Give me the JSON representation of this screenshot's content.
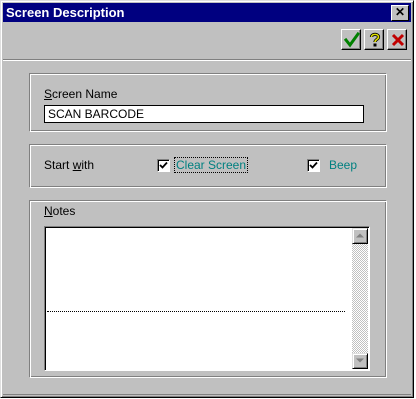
{
  "window": {
    "title": "Screen Description",
    "close_glyph": "✕"
  },
  "toolbar": {
    "ok_icon": "green-checkmark-icon",
    "help_icon": "question-mark-icon",
    "cancel_icon": "red-x-icon",
    "colors": {
      "ok": "#008000",
      "help": "#808000",
      "cancel": "#c00000"
    }
  },
  "screen_name": {
    "label_hotkey": "S",
    "label_rest": "creen Name",
    "value": "SCAN BARCODE"
  },
  "start_with": {
    "label_pre": "Start ",
    "label_hotkey": "w",
    "label_post": "ith",
    "clear_screen": {
      "label": "Clear Screen",
      "checked": true
    },
    "beep": {
      "label": "Beep",
      "checked": true
    }
  },
  "notes": {
    "label_hotkey": "N",
    "label_rest": "otes",
    "value": ""
  },
  "colors": {
    "titlebar": "#000080",
    "face": "#c0c0c0",
    "option_text": "#008080"
  }
}
